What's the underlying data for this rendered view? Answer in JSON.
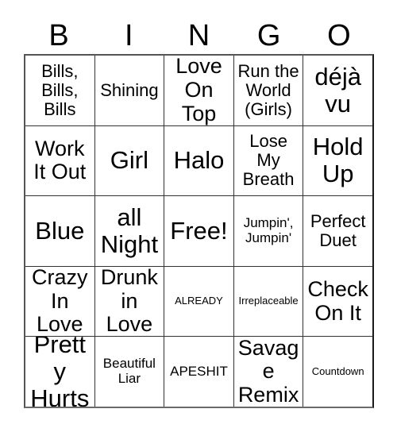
{
  "card": {
    "header_letters": [
      "B",
      "I",
      "N",
      "G",
      "O"
    ],
    "rows": [
      [
        {
          "text": "Bills, Bills, Bills",
          "size": "fs-md"
        },
        {
          "text": "Shining",
          "size": "fs-md"
        },
        {
          "text": "Love On Top",
          "size": "fs-lg"
        },
        {
          "text": "Run the World (Girls)",
          "size": "fs-md"
        },
        {
          "text": "déjà vu",
          "size": "fs-xl"
        }
      ],
      [
        {
          "text": "Work It Out",
          "size": "fs-lg"
        },
        {
          "text": "Girl",
          "size": "fs-xl"
        },
        {
          "text": "Halo",
          "size": "fs-xl"
        },
        {
          "text": "Lose My Breath",
          "size": "fs-md"
        },
        {
          "text": "Hold Up",
          "size": "fs-xl"
        }
      ],
      [
        {
          "text": "Blue",
          "size": "fs-xl"
        },
        {
          "text": "all Night",
          "size": "fs-xl"
        },
        {
          "text": "Free!",
          "size": "fs-xl"
        },
        {
          "text": "Jumpin', Jumpin'",
          "size": "fs-sm"
        },
        {
          "text": "Perfect Duet",
          "size": "fs-md"
        }
      ],
      [
        {
          "text": "Crazy In Love",
          "size": "fs-lg"
        },
        {
          "text": "Drunk in Love",
          "size": "fs-lg"
        },
        {
          "text": "ALREADY",
          "size": "fs-xs"
        },
        {
          "text": "Irreplaceable",
          "size": "fs-xs"
        },
        {
          "text": "Check On It",
          "size": "fs-lg"
        }
      ],
      [
        {
          "text": "Pretty Hurts",
          "size": "fs-xl"
        },
        {
          "text": "Beautiful Liar",
          "size": "fs-sm"
        },
        {
          "text": "APESHIT",
          "size": "fs-sm"
        },
        {
          "text": "Savage Remix",
          "size": "fs-lg"
        },
        {
          "text": "Countdown",
          "size": "fs-xs"
        }
      ]
    ]
  }
}
